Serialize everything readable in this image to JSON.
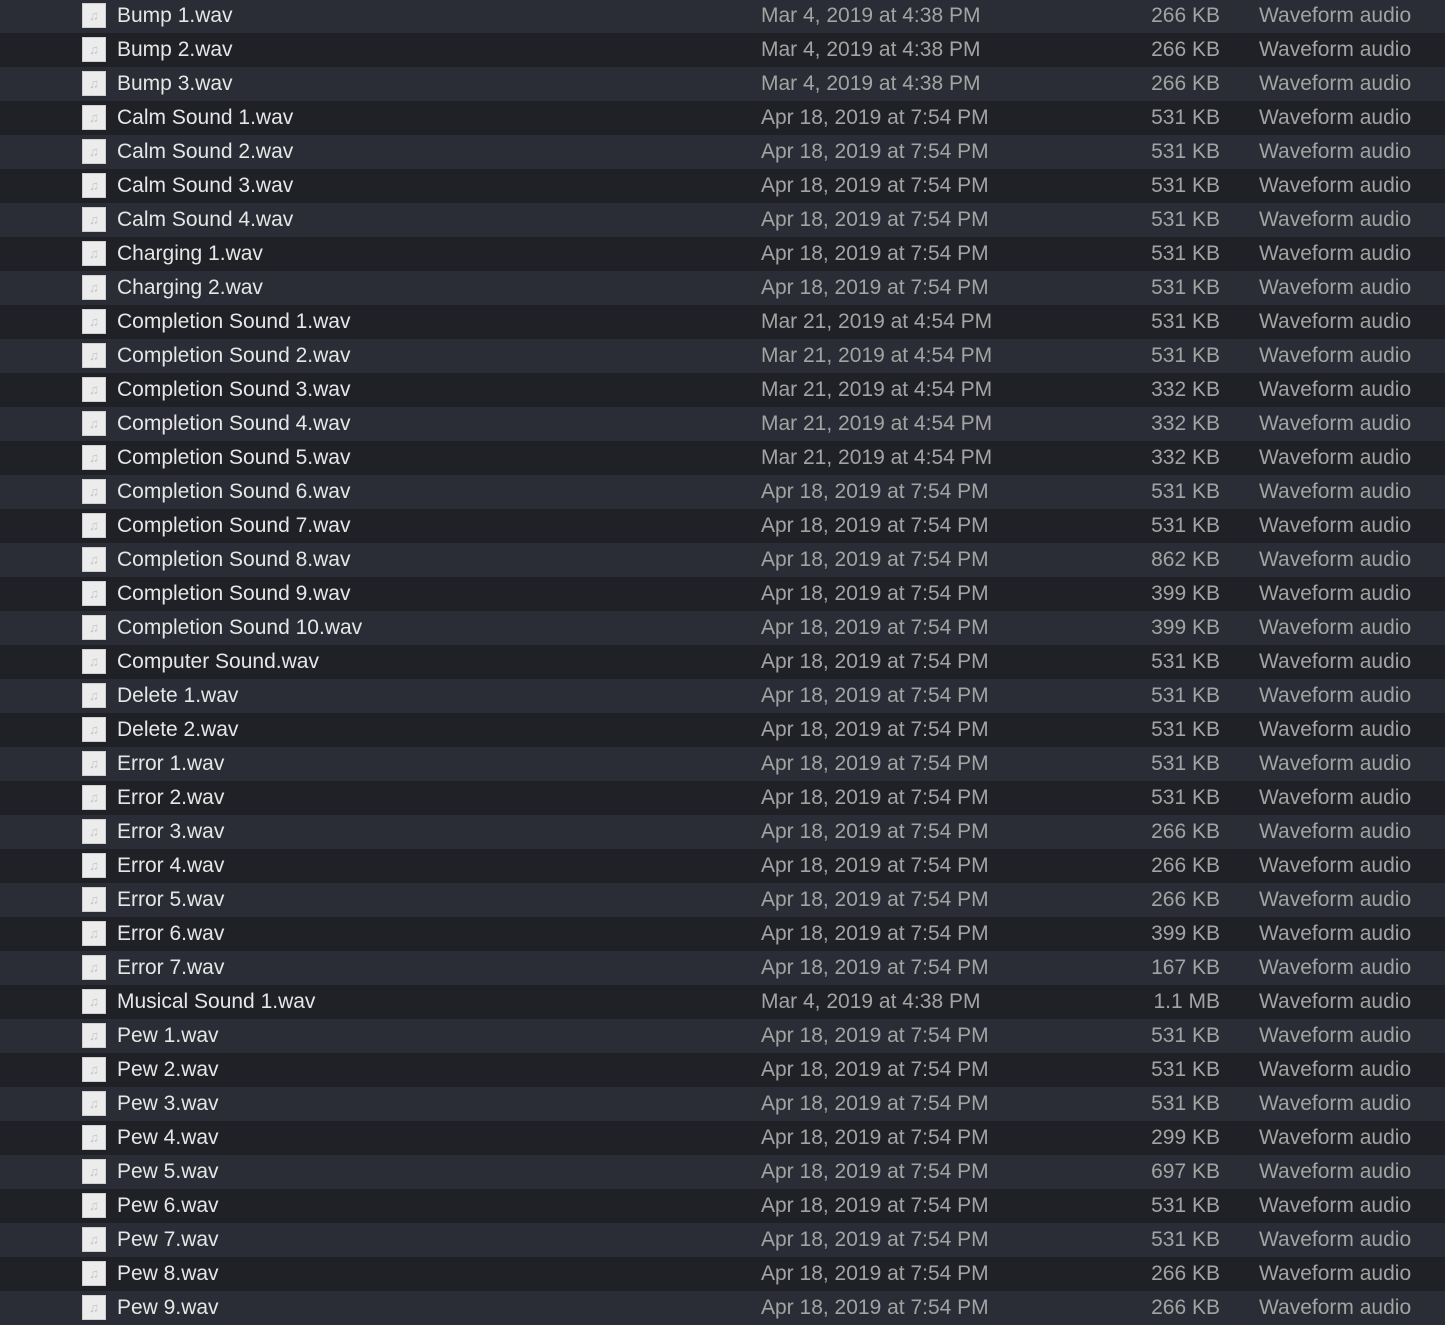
{
  "file_icon": "music-note-file-icon",
  "files": [
    {
      "name": "Bump 1.wav",
      "date": "Mar 4, 2019 at 4:38 PM",
      "size": "266 KB",
      "kind": "Waveform audio"
    },
    {
      "name": "Bump 2.wav",
      "date": "Mar 4, 2019 at 4:38 PM",
      "size": "266 KB",
      "kind": "Waveform audio"
    },
    {
      "name": "Bump 3.wav",
      "date": "Mar 4, 2019 at 4:38 PM",
      "size": "266 KB",
      "kind": "Waveform audio"
    },
    {
      "name": "Calm Sound 1.wav",
      "date": "Apr 18, 2019 at 7:54 PM",
      "size": "531 KB",
      "kind": "Waveform audio"
    },
    {
      "name": "Calm Sound 2.wav",
      "date": "Apr 18, 2019 at 7:54 PM",
      "size": "531 KB",
      "kind": "Waveform audio"
    },
    {
      "name": "Calm Sound 3.wav",
      "date": "Apr 18, 2019 at 7:54 PM",
      "size": "531 KB",
      "kind": "Waveform audio"
    },
    {
      "name": "Calm Sound 4.wav",
      "date": "Apr 18, 2019 at 7:54 PM",
      "size": "531 KB",
      "kind": "Waveform audio"
    },
    {
      "name": "Charging 1.wav",
      "date": "Apr 18, 2019 at 7:54 PM",
      "size": "531 KB",
      "kind": "Waveform audio"
    },
    {
      "name": "Charging 2.wav",
      "date": "Apr 18, 2019 at 7:54 PM",
      "size": "531 KB",
      "kind": "Waveform audio"
    },
    {
      "name": "Completion Sound 1.wav",
      "date": "Mar 21, 2019 at 4:54 PM",
      "size": "531 KB",
      "kind": "Waveform audio"
    },
    {
      "name": "Completion Sound 2.wav",
      "date": "Mar 21, 2019 at 4:54 PM",
      "size": "531 KB",
      "kind": "Waveform audio"
    },
    {
      "name": "Completion Sound 3.wav",
      "date": "Mar 21, 2019 at 4:54 PM",
      "size": "332 KB",
      "kind": "Waveform audio"
    },
    {
      "name": "Completion Sound 4.wav",
      "date": "Mar 21, 2019 at 4:54 PM",
      "size": "332 KB",
      "kind": "Waveform audio"
    },
    {
      "name": "Completion Sound 5.wav",
      "date": "Mar 21, 2019 at 4:54 PM",
      "size": "332 KB",
      "kind": "Waveform audio"
    },
    {
      "name": "Completion Sound 6.wav",
      "date": "Apr 18, 2019 at 7:54 PM",
      "size": "531 KB",
      "kind": "Waveform audio"
    },
    {
      "name": "Completion Sound 7.wav",
      "date": "Apr 18, 2019 at 7:54 PM",
      "size": "531 KB",
      "kind": "Waveform audio"
    },
    {
      "name": "Completion Sound 8.wav",
      "date": "Apr 18, 2019 at 7:54 PM",
      "size": "862 KB",
      "kind": "Waveform audio"
    },
    {
      "name": "Completion Sound 9.wav",
      "date": "Apr 18, 2019 at 7:54 PM",
      "size": "399 KB",
      "kind": "Waveform audio"
    },
    {
      "name": "Completion Sound 10.wav",
      "date": "Apr 18, 2019 at 7:54 PM",
      "size": "399 KB",
      "kind": "Waveform audio"
    },
    {
      "name": "Computer Sound.wav",
      "date": "Apr 18, 2019 at 7:54 PM",
      "size": "531 KB",
      "kind": "Waveform audio"
    },
    {
      "name": "Delete 1.wav",
      "date": "Apr 18, 2019 at 7:54 PM",
      "size": "531 KB",
      "kind": "Waveform audio"
    },
    {
      "name": "Delete 2.wav",
      "date": "Apr 18, 2019 at 7:54 PM",
      "size": "531 KB",
      "kind": "Waveform audio"
    },
    {
      "name": "Error 1.wav",
      "date": "Apr 18, 2019 at 7:54 PM",
      "size": "531 KB",
      "kind": "Waveform audio"
    },
    {
      "name": "Error 2.wav",
      "date": "Apr 18, 2019 at 7:54 PM",
      "size": "531 KB",
      "kind": "Waveform audio"
    },
    {
      "name": "Error 3.wav",
      "date": "Apr 18, 2019 at 7:54 PM",
      "size": "266 KB",
      "kind": "Waveform audio"
    },
    {
      "name": "Error 4.wav",
      "date": "Apr 18, 2019 at 7:54 PM",
      "size": "266 KB",
      "kind": "Waveform audio"
    },
    {
      "name": "Error 5.wav",
      "date": "Apr 18, 2019 at 7:54 PM",
      "size": "266 KB",
      "kind": "Waveform audio"
    },
    {
      "name": "Error 6.wav",
      "date": "Apr 18, 2019 at 7:54 PM",
      "size": "399 KB",
      "kind": "Waveform audio"
    },
    {
      "name": "Error 7.wav",
      "date": "Apr 18, 2019 at 7:54 PM",
      "size": "167 KB",
      "kind": "Waveform audio"
    },
    {
      "name": "Musical Sound 1.wav",
      "date": "Mar 4, 2019 at 4:38 PM",
      "size": "1.1 MB",
      "kind": "Waveform audio"
    },
    {
      "name": "Pew 1.wav",
      "date": "Apr 18, 2019 at 7:54 PM",
      "size": "531 KB",
      "kind": "Waveform audio"
    },
    {
      "name": "Pew 2.wav",
      "date": "Apr 18, 2019 at 7:54 PM",
      "size": "531 KB",
      "kind": "Waveform audio"
    },
    {
      "name": "Pew 3.wav",
      "date": "Apr 18, 2019 at 7:54 PM",
      "size": "531 KB",
      "kind": "Waveform audio"
    },
    {
      "name": "Pew 4.wav",
      "date": "Apr 18, 2019 at 7:54 PM",
      "size": "299 KB",
      "kind": "Waveform audio"
    },
    {
      "name": "Pew 5.wav",
      "date": "Apr 18, 2019 at 7:54 PM",
      "size": "697 KB",
      "kind": "Waveform audio"
    },
    {
      "name": "Pew 6.wav",
      "date": "Apr 18, 2019 at 7:54 PM",
      "size": "531 KB",
      "kind": "Waveform audio"
    },
    {
      "name": "Pew 7.wav",
      "date": "Apr 18, 2019 at 7:54 PM",
      "size": "531 KB",
      "kind": "Waveform audio"
    },
    {
      "name": "Pew 8.wav",
      "date": "Apr 18, 2019 at 7:54 PM",
      "size": "266 KB",
      "kind": "Waveform audio"
    },
    {
      "name": "Pew 9.wav",
      "date": "Apr 18, 2019 at 7:54 PM",
      "size": "266 KB",
      "kind": "Waveform audio"
    }
  ]
}
